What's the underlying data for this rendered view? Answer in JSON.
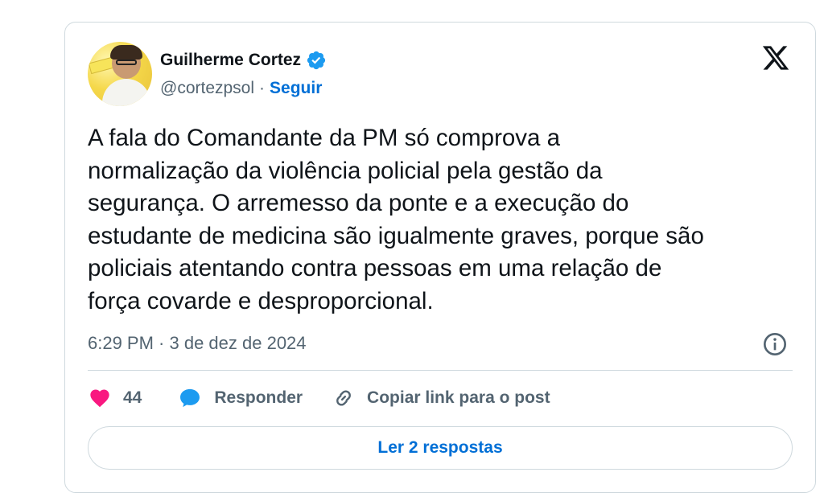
{
  "author": {
    "name": "Guilherme Cortez",
    "handle": "@cortezpsol",
    "separator": "·",
    "follow_label": "Seguir",
    "verified": true
  },
  "tweet": {
    "text": "A fala do Comandante da PM só comprova a\nnormalização da violência policial pela gestão da\nsegurança. O arremesso da ponte e a execução do\nestudante de medicina são igualmente graves, porque são\npoliciais atentando contra pessoas em uma relação de\nforça covarde e desproporcional.",
    "timestamp": "6:29 PM · 3 de dez de 2024"
  },
  "actions": {
    "like_count": "44",
    "reply_label": "Responder",
    "copy_link_label": "Copiar link para o post"
  },
  "read_replies_label": "Ler 2 respostas",
  "icons": {
    "verified": "verified-badge-icon",
    "brand": "x-logo-icon",
    "info": "info-icon",
    "like": "heart-icon",
    "reply": "speech-bubble-icon",
    "link": "link-icon"
  },
  "colors": {
    "link_blue": "#006fd6",
    "verified_blue": "#1d9bf0",
    "heart_pink": "#f91880",
    "muted_text": "#536471",
    "border": "#cfd9de"
  }
}
